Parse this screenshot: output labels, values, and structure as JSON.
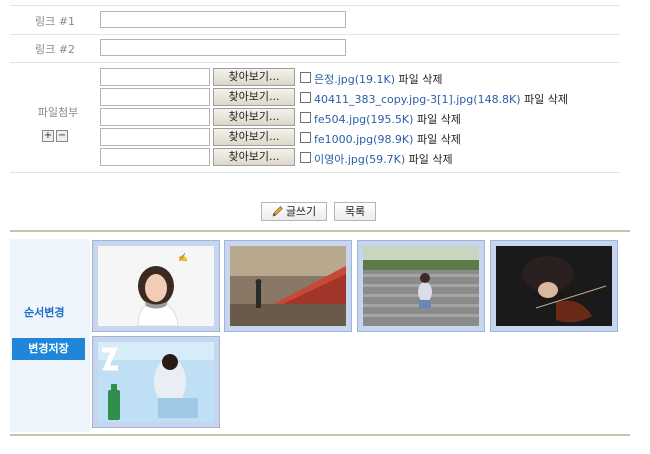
{
  "form": {
    "link1_label": "링크 #1",
    "link1_value": "",
    "link2_label": "링크 #2",
    "link2_value": "",
    "attach_label": "파일첨부",
    "add_symbol": "+",
    "remove_symbol": "−",
    "browse_label": "찾아보기...",
    "delete_label": "파일 삭제",
    "files": [
      {
        "name": "은정.jpg(19.1K)"
      },
      {
        "name": "40411_383_copy.jpg-3[1].jpg(148.8K)"
      },
      {
        "name": "fe504.jpg(195.5K)"
      },
      {
        "name": "fe1000.jpg(98.9K)"
      },
      {
        "name": "이영아.jpg(59.7K)"
      }
    ]
  },
  "actions": {
    "write_label": "글쓰기",
    "list_label": "목록"
  },
  "gallery": {
    "order_change_label": "순서변경",
    "save_changes_label": "변경저장",
    "thumbnails": [
      {
        "icon": "woman-portrait-photo"
      },
      {
        "icon": "train-platform-photo"
      },
      {
        "icon": "stairs-sitting-photo"
      },
      {
        "icon": "violin-photo"
      },
      {
        "icon": "poster-bottle-photo"
      }
    ]
  },
  "colors": {
    "accent": "#1f86d9",
    "link": "#2a5fa8",
    "panel_bg": "#eef5fd",
    "thumb_frame": "#c6d6ee"
  }
}
